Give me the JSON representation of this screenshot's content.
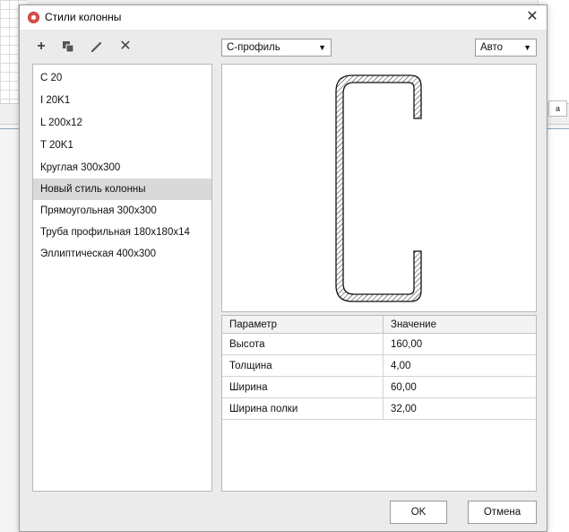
{
  "window": {
    "title": "Стили колонны",
    "close_glyph": "✕"
  },
  "toolbar": {
    "add_glyph": "+",
    "copy_glyph": "⧉",
    "edit_glyph": "✎",
    "delete_glyph": "✕"
  },
  "styles_list": {
    "items": [
      "C 20",
      "I 20K1",
      "L 200x12",
      "T 20K1",
      "Круглая 300x300",
      "Новый стиль колонны",
      "Прямоугольная 300x300",
      "Труба профильная 180x180x14",
      "Эллиптическая 400x300"
    ],
    "selected_index": 5
  },
  "profile_select": {
    "value": "С-профиль",
    "caret": "▼"
  },
  "scale_select": {
    "value": "Авто",
    "caret": "▼"
  },
  "params_table": {
    "headers": [
      "Параметр",
      "Значение"
    ],
    "rows": [
      [
        "Высота",
        "160,00"
      ],
      [
        "Толщина",
        "4,00"
      ],
      [
        "Ширина",
        "60,00"
      ],
      [
        "Ширина полки",
        "32,00"
      ]
    ]
  },
  "buttons": {
    "ok": "OK",
    "cancel": "Отмена"
  },
  "background": {
    "right_box_text": "a"
  },
  "colors": {
    "dialog_bg": "#ebebeb",
    "selected_row": "#d9d9d9",
    "app_icon": "#d9534f"
  }
}
